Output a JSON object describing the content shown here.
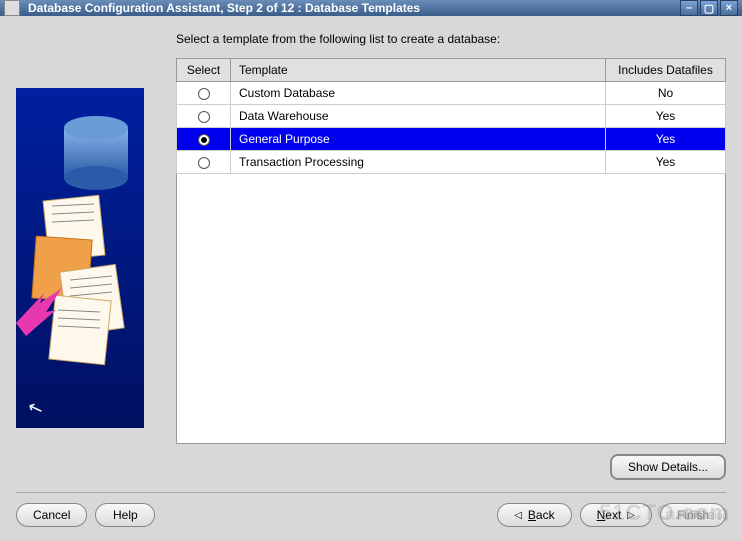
{
  "window": {
    "title": "Database Configuration Assistant, Step 2 of 12 : Database Templates"
  },
  "instruction": "Select a template from the following list to create a database:",
  "table": {
    "headers": {
      "select": "Select",
      "template": "Template",
      "includes": "Includes Datafiles"
    },
    "rows": [
      {
        "template": "Custom Database",
        "includes": "No",
        "selected": false
      },
      {
        "template": "Data Warehouse",
        "includes": "Yes",
        "selected": false
      },
      {
        "template": "General Purpose",
        "includes": "Yes",
        "selected": true
      },
      {
        "template": "Transaction Processing",
        "includes": "Yes",
        "selected": false
      }
    ]
  },
  "buttons": {
    "show_details": "Show Details...",
    "cancel": "Cancel",
    "help": "Help",
    "back_mnemonic": "B",
    "back_rest": "ack",
    "next_mnemonic": "N",
    "next_rest": "ext",
    "finish": "Finish"
  },
  "watermark": "51CTO.com",
  "watermark_sub": "技术博客 Blog"
}
